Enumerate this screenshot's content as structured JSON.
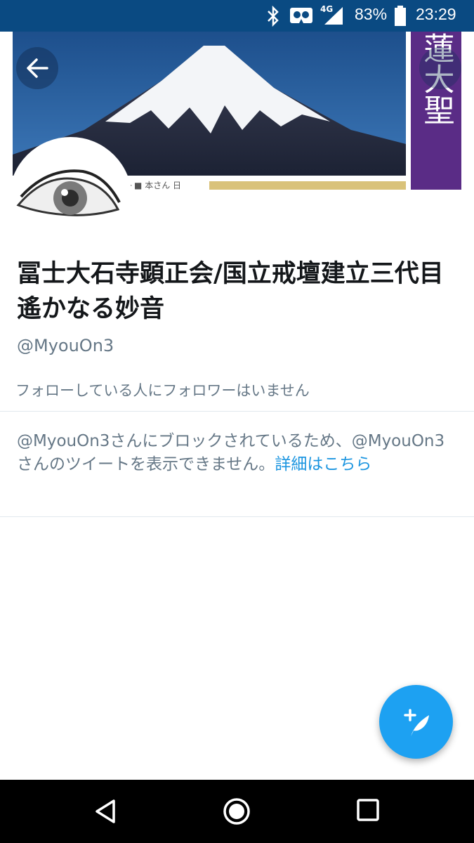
{
  "status_bar": {
    "network": "4G",
    "battery": "83%",
    "time": "23:29",
    "icons": [
      "bluetooth-icon",
      "vr-icon",
      "signal-icon",
      "battery-icon"
    ]
  },
  "banner": {
    "image": "mount-fuji-photo",
    "scroll_text": "日蓮大聖"
  },
  "profile": {
    "display_name": "冨士大石寺顕正会/国立戒壇建立三代目遙かなる妙音",
    "handle": "@MyouOn3",
    "follow_note": "フォローしている人にフォロワーはいません"
  },
  "blocked": {
    "message": "@MyouOn3さんにブロックされているため、@MyouOn3さんのツイートを表示できません。",
    "link": "詳細はこちら"
  },
  "colors": {
    "status_bar": "#0a4a82",
    "accent": "#1da1f2",
    "link": "#1b95e0",
    "secondary_text": "#657786"
  },
  "fab": {
    "icon": "compose-tweet-icon"
  },
  "nav": {
    "buttons": [
      "back-icon",
      "home-icon",
      "recents-icon"
    ]
  }
}
